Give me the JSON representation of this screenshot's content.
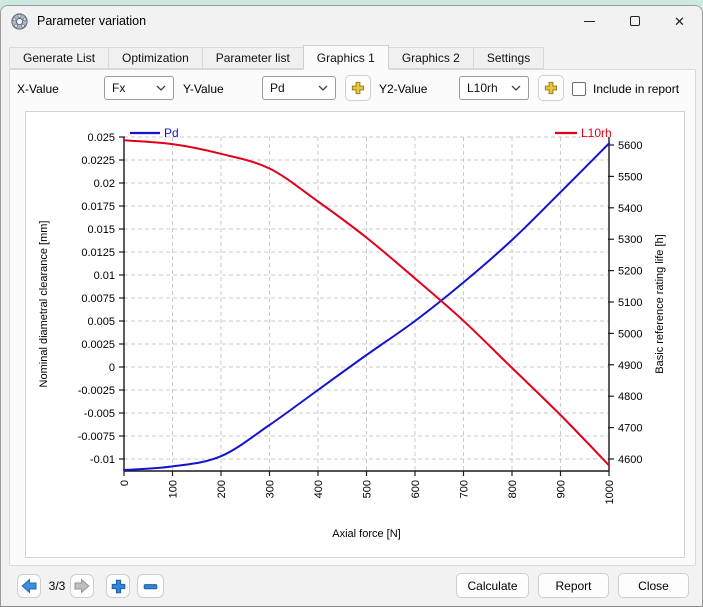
{
  "window": {
    "title": "Parameter variation",
    "controls": {
      "close_icon": "✕"
    }
  },
  "tabs": [
    {
      "label": "Generate List",
      "active": false
    },
    {
      "label": "Optimization",
      "active": false
    },
    {
      "label": "Parameter list",
      "active": false
    },
    {
      "label": "Graphics 1",
      "active": true
    },
    {
      "label": "Graphics 2",
      "active": false
    },
    {
      "label": "Settings",
      "active": false
    }
  ],
  "toolbar": {
    "x_label": "X-Value",
    "x_value": "Fx",
    "y_label": "Y-Value",
    "y_value": "Pd",
    "y2_label": "Y2-Value",
    "y2_value": "L10rh",
    "include_in_report_label": "Include in report",
    "include_in_report_checked": false,
    "add_icon_color": "#e8c53e"
  },
  "chart_data": {
    "type": "line",
    "x": [
      0,
      100,
      200,
      300,
      400,
      500,
      600,
      700,
      800,
      900,
      1000
    ],
    "x_tick_labels": [
      "0",
      "100",
      "200",
      "300",
      "400",
      "500",
      "600",
      "700",
      "800",
      "900",
      "1000"
    ],
    "xlabel": "Axial force [N]",
    "xlim": [
      0,
      1000
    ],
    "grid": true,
    "legend_position": "top-inside",
    "left_axis": {
      "label": "Nominal diametral clearance [mm]",
      "tick_max": 0.025,
      "tick_step": 0.0025,
      "ticks": [
        "0.025",
        "0.0225",
        "0.02",
        "0.0175",
        "0.015",
        "0.0125",
        "0.01",
        "0.0075",
        "0.005",
        "0.0025",
        "0",
        "-0.0025",
        "-0.005",
        "-0.0075",
        "-0.01"
      ]
    },
    "right_axis": {
      "label": "Basic reference rating life [h]",
      "tick_max": 5600,
      "tick_step": 100,
      "ticks": [
        "5600",
        "5500",
        "5400",
        "5300",
        "5200",
        "5100",
        "5000",
        "4900",
        "4800",
        "4700",
        "4600"
      ]
    },
    "series": [
      {
        "name": "Pd",
        "axis": "left",
        "color": "#1414cd",
        "values": [
          -0.0112,
          -0.0108,
          -0.0097,
          -0.0063,
          -0.0025,
          0.0013,
          0.005,
          0.0092,
          0.0138,
          0.019,
          0.0243
        ]
      },
      {
        "name": "L10rh",
        "axis": "right",
        "color": "#e2001a",
        "values": [
          5615,
          5603,
          5572,
          5525,
          5420,
          5305,
          5175,
          5040,
          4890,
          4740,
          4580
        ]
      }
    ]
  },
  "footer": {
    "page_indicator": "3/3",
    "calculate_label": "Calculate",
    "report_label": "Report",
    "close_label": "Close"
  }
}
